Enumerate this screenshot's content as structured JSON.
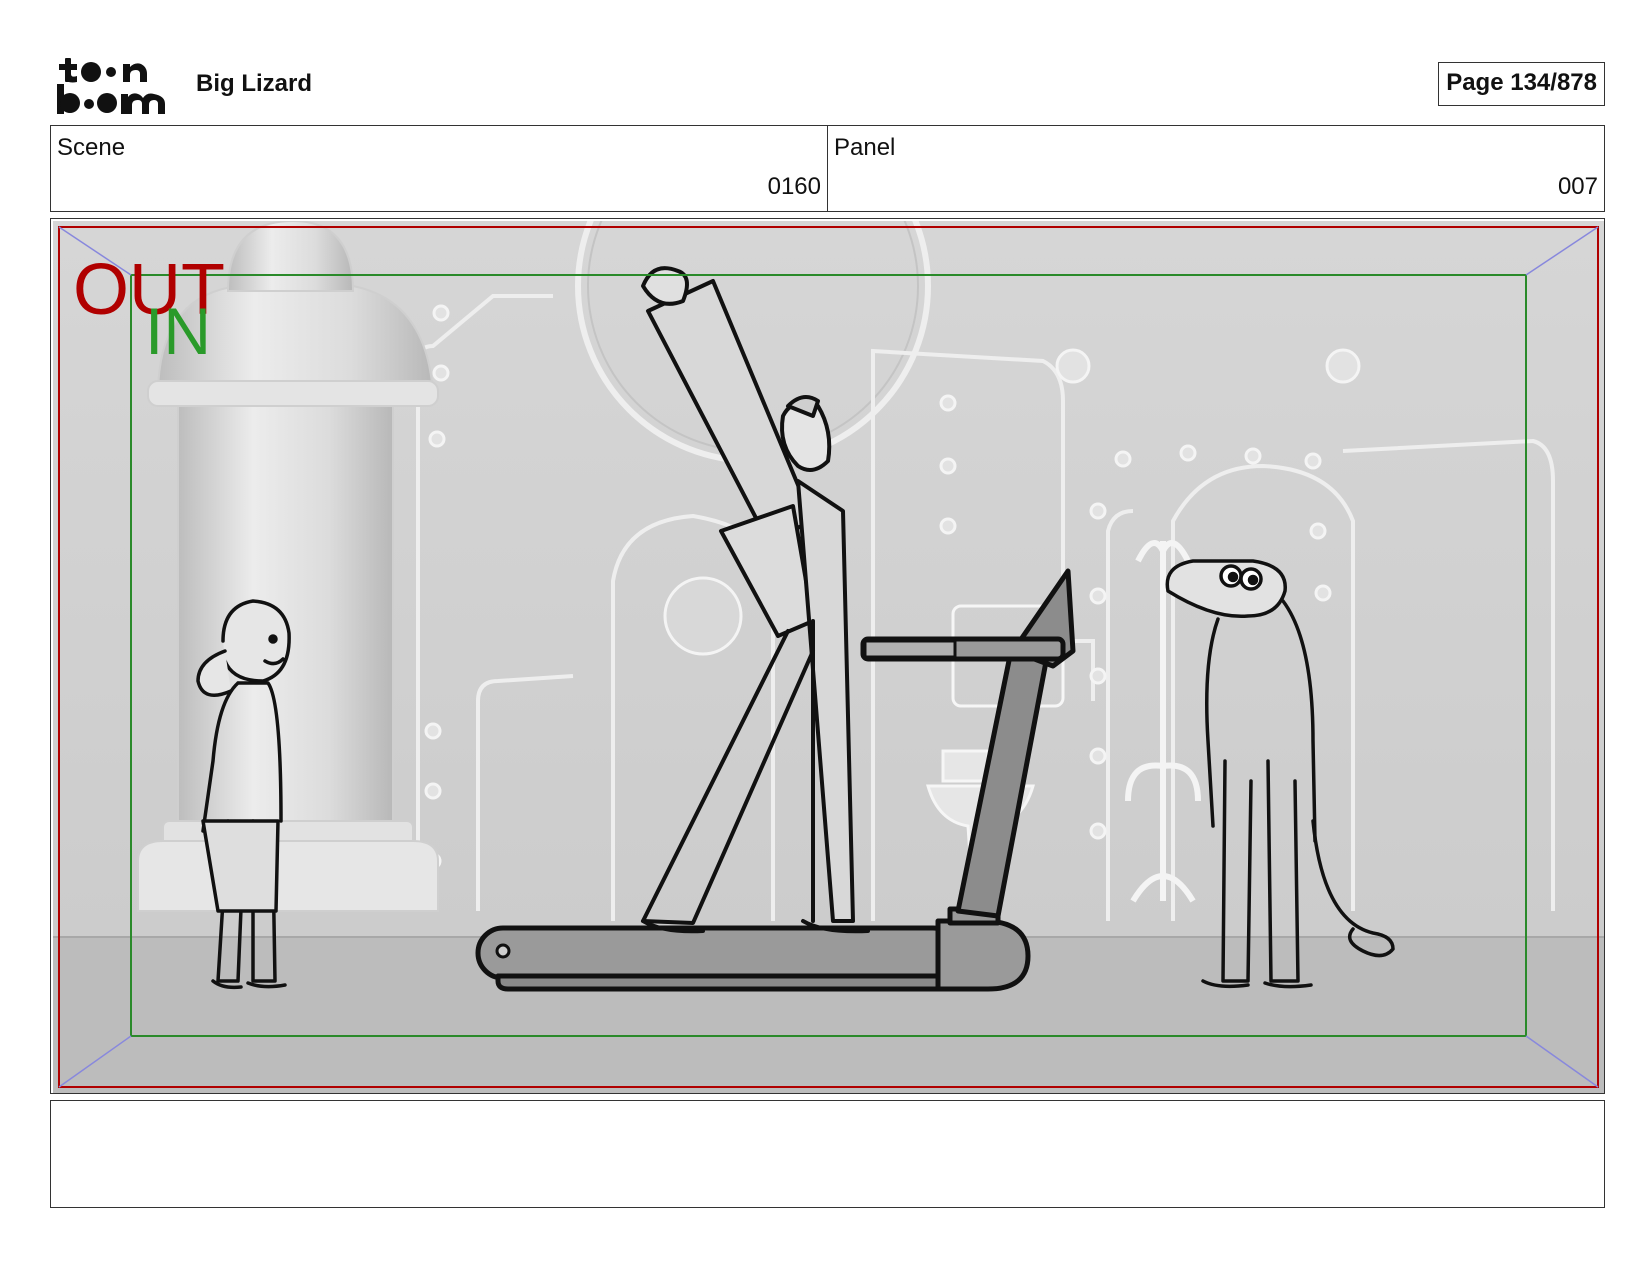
{
  "header": {
    "logo_alt": "toon boom",
    "project_title": "Big Lizard",
    "page_label": "Page 134/878"
  },
  "info": {
    "scene_label": "Scene",
    "scene_value": "0160",
    "panel_label": "Panel",
    "panel_value": "007"
  },
  "frame_marks": {
    "out_label": "OUT",
    "in_label": "IN",
    "out_color": "#b00000",
    "in_color": "#2a9a2a"
  },
  "notes": {
    "text": ""
  }
}
